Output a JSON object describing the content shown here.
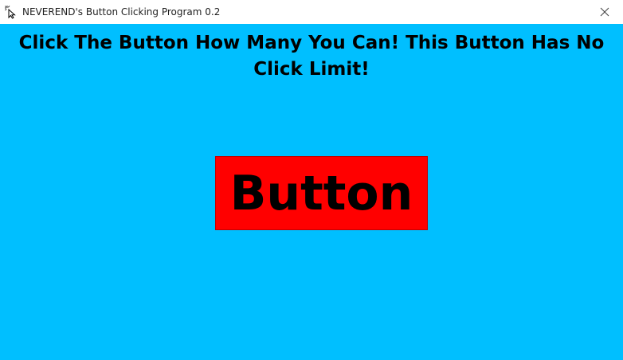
{
  "window": {
    "title": "NEVEREND's Button Clicking Program 0.2",
    "app_icon": "cursor-click-icon",
    "close_icon": "close-icon"
  },
  "main": {
    "headline": "Click The Button How Many You Can! This Button Has No Click Limit!",
    "button_label": "Button"
  },
  "colors": {
    "background": "#00bfff",
    "button": "#ff0000",
    "text": "#000000"
  }
}
